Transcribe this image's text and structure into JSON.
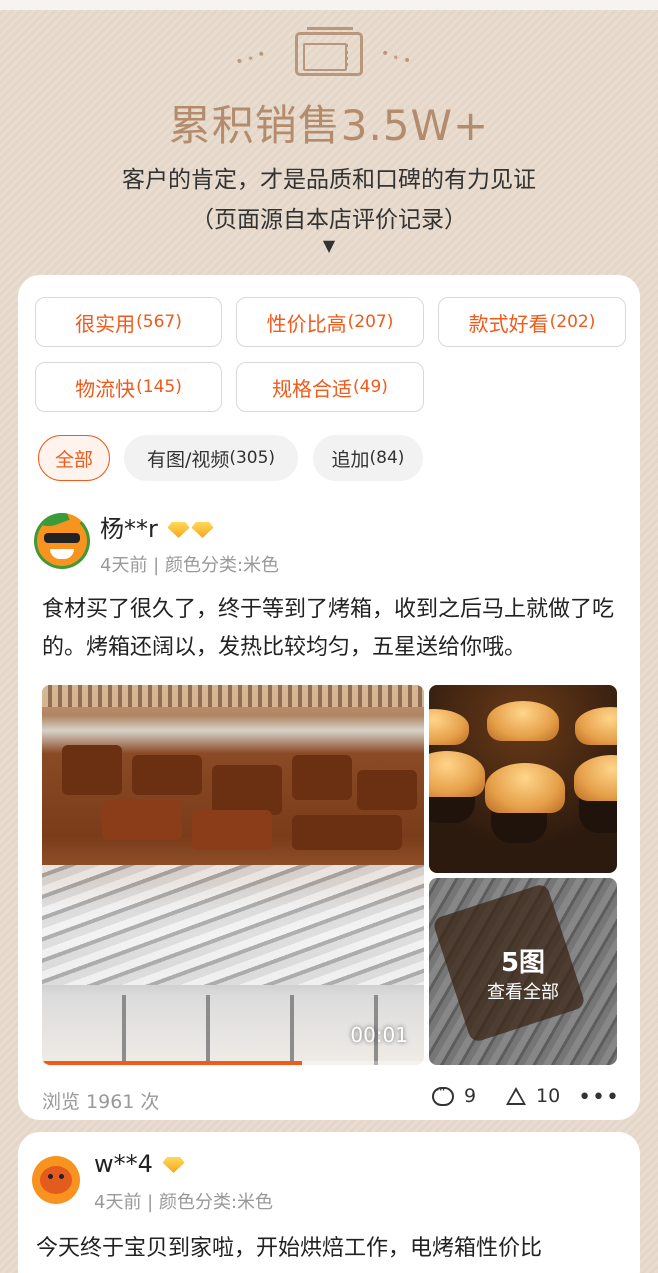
{
  "header": {
    "sales_title": "累积销售3.5W+",
    "subtitle": "客户的肯定，才是品质和口碑的有力见证",
    "note": "（页面源自本店评价记录）",
    "arrow": "▼",
    "sparkle_left": "•⋆•",
    "sparkle_right": "•⋆•"
  },
  "tags": [
    {
      "label": "很实用",
      "count": "(567)"
    },
    {
      "label": "性价比高",
      "count": "(207)"
    },
    {
      "label": "款式好看",
      "count": "(202)"
    },
    {
      "label": "物流快",
      "count": "(145)"
    },
    {
      "label": "规格合适",
      "count": "(49)"
    }
  ],
  "filters": [
    {
      "label": "全部",
      "count": ""
    },
    {
      "label": "有图/视频",
      "count": "(305)"
    },
    {
      "label": "追加",
      "count": "(84)"
    }
  ],
  "review1": {
    "user": "杨**r",
    "meta": "4天前 | 颜色分类:米色",
    "text": "食材买了很久了，终于等到了烤箱，收到之后马上就做了吃的。烤箱还阔以，发热比较均匀，五星送给你哦。",
    "video_duration": "00:01",
    "video_progress": 0.68,
    "photo_count": "5图",
    "view_all": "查看全部",
    "views": "浏览 1961 次",
    "comments": "9",
    "likes": "10",
    "more": "•••"
  },
  "review2": {
    "user": "w**4",
    "meta": "4天前 | 颜色分类:米色",
    "text": "今天终于宝贝到家啦，开始烘焙工作，电烤箱性价比"
  },
  "colors": {
    "accent": "#f05a1a",
    "title": "#b38c6e",
    "muted": "#999999"
  }
}
